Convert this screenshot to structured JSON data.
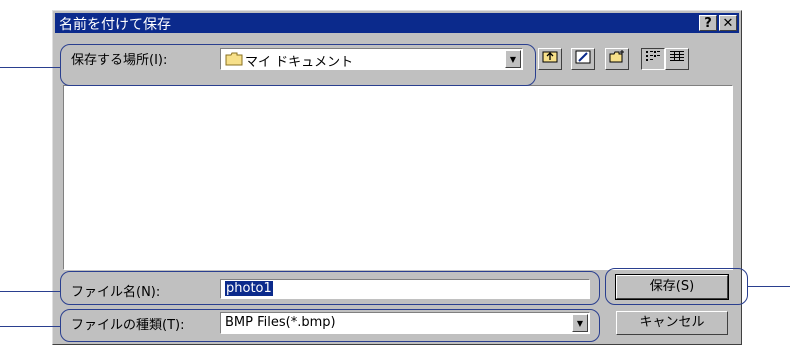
{
  "dialog": {
    "title": "名前を付けて保存",
    "help_label": "?",
    "close_label": "✕"
  },
  "location": {
    "label": "保存する場所(I):",
    "value": "マイ ドキュメント",
    "dropdown_glyph": "▼"
  },
  "toolbar": {
    "up_icon": "up-folder-icon",
    "desktop_icon": "desktop-icon",
    "new_folder_icon": "new-folder-icon",
    "list_view_icon": "list-view-icon",
    "details_view_icon": "details-view-icon"
  },
  "filename": {
    "label": "ファイル名(N):",
    "value": "photo1"
  },
  "filetype": {
    "label": "ファイルの種類(T):",
    "value": "BMP Files(*.bmp)",
    "dropdown_glyph": "▼"
  },
  "buttons": {
    "save": "保存(S)",
    "cancel": "キャンセル"
  },
  "colors": {
    "titlebar": "#0b2a8c",
    "dialog_face": "#c0c0c0",
    "callout": "#2a3f8f"
  }
}
